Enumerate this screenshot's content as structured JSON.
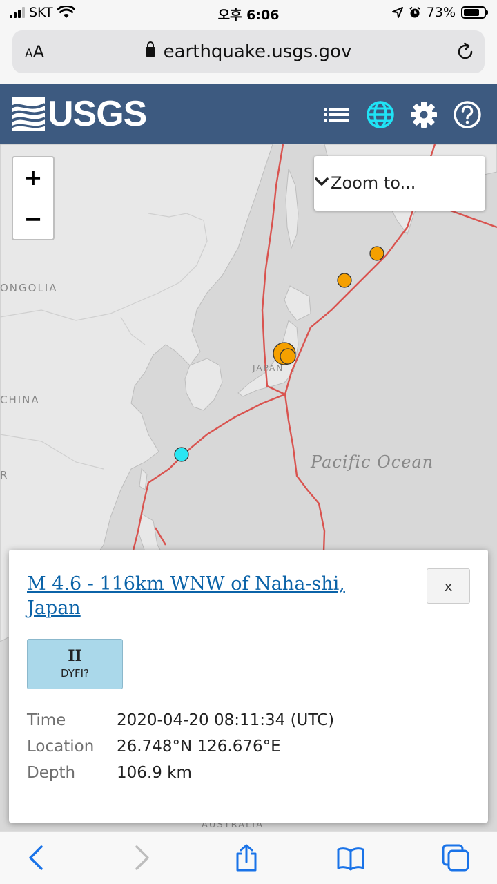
{
  "status_bar": {
    "carrier": "SKT",
    "time": "오후 6:06",
    "battery": "73%"
  },
  "browser": {
    "text_size_label": "AA",
    "url": "earthquake.usgs.gov"
  },
  "header": {
    "logo_text": "USGS",
    "icons": [
      "list-icon",
      "globe-icon",
      "gear-icon",
      "help-icon"
    ]
  },
  "map": {
    "zoom_in": "+",
    "zoom_out": "−",
    "zoom_to_label": "Zoom to...",
    "labels": {
      "mongolia": "ONGOLIA",
      "china": "CHINA",
      "japan": "JAPAN",
      "ocean": "Pacific Ocean",
      "australia": "AUSTRALIA",
      "r": "R"
    },
    "colors": {
      "plate_boundary": "#d9534f",
      "older_quake": "#f5a000",
      "recent_quake": "#29e6f2"
    }
  },
  "popup": {
    "title": "M 4.6 - 116km WNW of Naha-shi, Japan",
    "close_label": "x",
    "dyfi_intensity": "II",
    "dyfi_label": "DYFI?",
    "details": [
      {
        "key": "Time",
        "value": "2020-04-20 08:11:34 (UTC)"
      },
      {
        "key": "Location",
        "value": "26.748°N 126.676°E"
      },
      {
        "key": "Depth",
        "value": "106.9 km"
      }
    ]
  },
  "toolbar": {
    "icons": [
      "back-icon",
      "forward-icon",
      "share-icon",
      "bookmarks-icon",
      "tabs-icon"
    ]
  }
}
